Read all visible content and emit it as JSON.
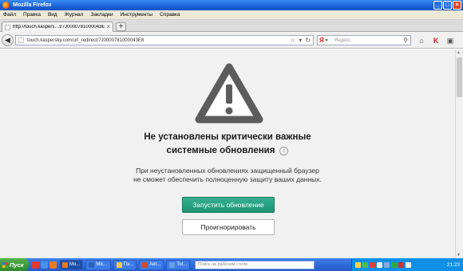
{
  "window": {
    "title": "Mozilla Firefox"
  },
  "menu": [
    "Файл",
    "Правка",
    "Вид",
    "Журнал",
    "Закладки",
    "Инструменты",
    "Справка"
  ],
  "tab": {
    "label": "http://touch.kaspers…t/7J0000781000043E8"
  },
  "nav": {
    "url": "touch.kaspersky.com/url_redirect/7J0000781000043E8",
    "search_placeholder": "Яндекс"
  },
  "page": {
    "headline_line1": "Не установлены критически важные",
    "headline_line2": "системные обновления",
    "desc_line1": "При неустановленных обновлениях защищенный браузер",
    "desc_line2": "не сможет обеспечить полноценную защиту ваших данных.",
    "primary_button": "Запустить обновление",
    "secondary_button": "Проигнорировать",
    "info_glyph": "i"
  },
  "taskbar": {
    "start_label": "Пуск",
    "tasks": [
      "Mo...",
      "Mic...",
      "Пэ...",
      "Авт...",
      "Tot..."
    ],
    "search_placeholder": "Поиск на рабочем столе",
    "clock": "21:23"
  },
  "colors": {
    "primary": "#1e9574",
    "titlebar": "#1a5fd6",
    "taskbar": "#2458c8"
  }
}
